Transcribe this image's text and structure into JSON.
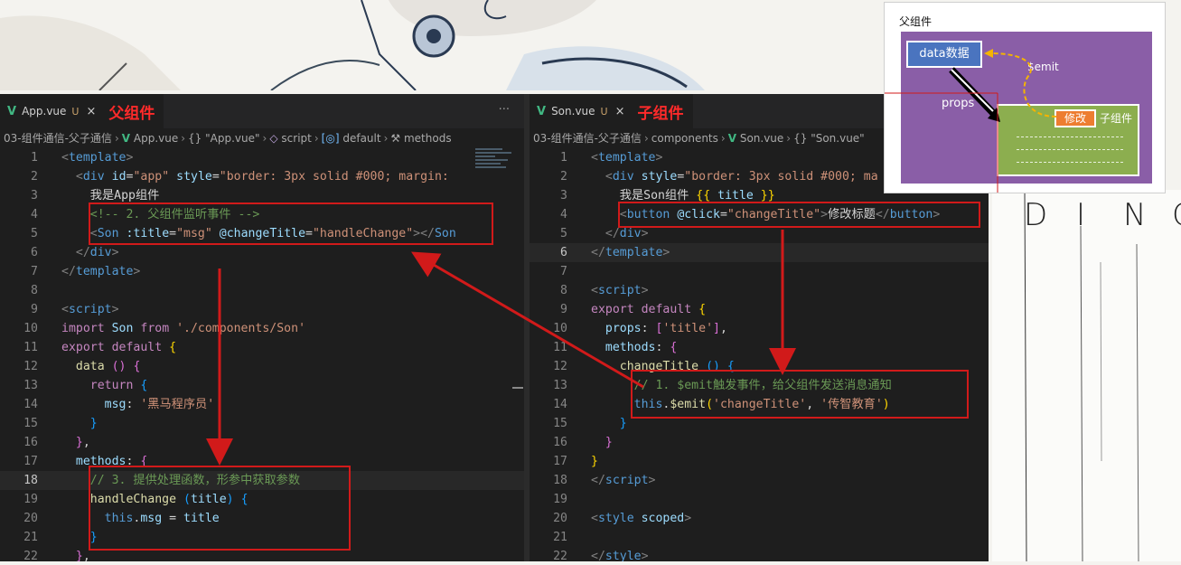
{
  "left_editor": {
    "tab_name": "App.vue",
    "tab_status": "U",
    "annotation": "父组件",
    "more": "···",
    "breadcrumb": [
      "03-组件通信-父子通信",
      "App.vue",
      "{} \"App.vue\"",
      "script",
      "default",
      "methods"
    ],
    "lines": [
      [
        [
          "t-punc",
          "<"
        ],
        [
          "t-tag",
          "template"
        ],
        [
          "t-punc",
          ">"
        ]
      ],
      [
        [
          "t-plain",
          "  "
        ],
        [
          "t-punc",
          "<"
        ],
        [
          "t-tag",
          "div"
        ],
        [
          "t-plain",
          " "
        ],
        [
          "t-attr",
          "id"
        ],
        [
          "t-plain",
          "="
        ],
        [
          "t-str",
          "\"app\""
        ],
        [
          "t-plain",
          " "
        ],
        [
          "t-attr",
          "style"
        ],
        [
          "t-plain",
          "="
        ],
        [
          "t-str",
          "\"border: 3px solid #000; margin:"
        ]
      ],
      [
        [
          "t-plain",
          "    我是App组件"
        ]
      ],
      [
        [
          "t-plain",
          "    "
        ],
        [
          "t-com",
          "<!-- 2. 父组件监听事件 -->"
        ]
      ],
      [
        [
          "t-plain",
          "    "
        ],
        [
          "t-punc",
          "<"
        ],
        [
          "t-tag",
          "Son"
        ],
        [
          "t-plain",
          " "
        ],
        [
          "t-attr",
          ":title"
        ],
        [
          "t-plain",
          "="
        ],
        [
          "t-str",
          "\"msg\""
        ],
        [
          "t-plain",
          " "
        ],
        [
          "t-attr",
          "@changeTitle"
        ],
        [
          "t-plain",
          "="
        ],
        [
          "t-str",
          "\"handleChange\""
        ],
        [
          "t-punc",
          "></"
        ],
        [
          "t-tag",
          "Son"
        ]
      ],
      [
        [
          "t-plain",
          "  "
        ],
        [
          "t-punc",
          "</"
        ],
        [
          "t-tag",
          "div"
        ],
        [
          "t-punc",
          ">"
        ]
      ],
      [
        [
          "t-punc",
          "</"
        ],
        [
          "t-tag",
          "template"
        ],
        [
          "t-punc",
          ">"
        ]
      ],
      [
        [
          "t-plain",
          ""
        ]
      ],
      [
        [
          "t-punc",
          "<"
        ],
        [
          "t-tag",
          "script"
        ],
        [
          "t-punc",
          ">"
        ]
      ],
      [
        [
          "t-kw",
          "import"
        ],
        [
          "t-plain",
          " "
        ],
        [
          "t-prop",
          "Son"
        ],
        [
          "t-plain",
          " "
        ],
        [
          "t-kw",
          "from"
        ],
        [
          "t-plain",
          " "
        ],
        [
          "t-str",
          "'./components/Son'"
        ]
      ],
      [
        [
          "t-kw",
          "export"
        ],
        [
          "t-plain",
          " "
        ],
        [
          "t-kw",
          "default"
        ],
        [
          "t-plain",
          " "
        ],
        [
          "t-br1",
          "{"
        ]
      ],
      [
        [
          "t-plain",
          "  "
        ],
        [
          "t-fn",
          "data"
        ],
        [
          "t-plain",
          " "
        ],
        [
          "t-br2",
          "()"
        ],
        [
          "t-plain",
          " "
        ],
        [
          "t-br2",
          "{"
        ]
      ],
      [
        [
          "t-plain",
          "    "
        ],
        [
          "t-kw",
          "return"
        ],
        [
          "t-plain",
          " "
        ],
        [
          "t-br3",
          "{"
        ]
      ],
      [
        [
          "t-plain",
          "      "
        ],
        [
          "t-prop",
          "msg"
        ],
        [
          "t-plain",
          ": "
        ],
        [
          "t-str",
          "'黑马程序员'"
        ]
      ],
      [
        [
          "t-plain",
          "    "
        ],
        [
          "t-br3",
          "}"
        ]
      ],
      [
        [
          "t-plain",
          "  "
        ],
        [
          "t-br2",
          "}"
        ],
        [
          "t-plain",
          ","
        ]
      ],
      [
        [
          "t-plain",
          "  "
        ],
        [
          "t-prop",
          "methods"
        ],
        [
          "t-plain",
          ": "
        ],
        [
          "t-br2",
          "{"
        ]
      ],
      [
        [
          "t-plain",
          "    "
        ],
        [
          "t-com",
          "// 3. 提供处理函数，形参中获取参数"
        ]
      ],
      [
        [
          "t-plain",
          "    "
        ],
        [
          "t-fn",
          "handleChange"
        ],
        [
          "t-plain",
          " "
        ],
        [
          "t-br3",
          "("
        ],
        [
          "t-prop",
          "title"
        ],
        [
          "t-br3",
          ")"
        ],
        [
          "t-plain",
          " "
        ],
        [
          "t-br3",
          "{"
        ]
      ],
      [
        [
          "t-plain",
          "      "
        ],
        [
          "t-this",
          "this"
        ],
        [
          "t-plain",
          "."
        ],
        [
          "t-prop",
          "msg"
        ],
        [
          "t-plain",
          " = "
        ],
        [
          "t-prop",
          "title"
        ]
      ],
      [
        [
          "t-plain",
          "    "
        ],
        [
          "t-br3",
          "}"
        ]
      ],
      [
        [
          "t-plain",
          "  "
        ],
        [
          "t-br2",
          "}"
        ],
        [
          "t-plain",
          ","
        ]
      ]
    ],
    "active_line": 18
  },
  "right_editor": {
    "tab_name": "Son.vue",
    "tab_status": "U",
    "annotation": "子组件",
    "breadcrumb": [
      "03-组件通信-父子通信",
      "components",
      "Son.vue",
      "{} \"Son.vue\""
    ],
    "lines": [
      [
        [
          "t-punc",
          "<"
        ],
        [
          "t-tag",
          "template"
        ],
        [
          "t-punc",
          ">"
        ]
      ],
      [
        [
          "t-plain",
          "  "
        ],
        [
          "t-punc",
          "<"
        ],
        [
          "t-tag",
          "div"
        ],
        [
          "t-plain",
          " "
        ],
        [
          "t-attr",
          "style"
        ],
        [
          "t-plain",
          "="
        ],
        [
          "t-str",
          "\"border: 3px solid #000; ma"
        ]
      ],
      [
        [
          "t-plain",
          "    我是Son组件 "
        ],
        [
          "t-br1",
          "{{"
        ],
        [
          "t-plain",
          " "
        ],
        [
          "t-prop",
          "title"
        ],
        [
          "t-plain",
          " "
        ],
        [
          "t-br1",
          "}}"
        ]
      ],
      [
        [
          "t-plain",
          "    "
        ],
        [
          "t-punc",
          "<"
        ],
        [
          "t-tag",
          "button"
        ],
        [
          "t-plain",
          " "
        ],
        [
          "t-attr",
          "@click"
        ],
        [
          "t-plain",
          "="
        ],
        [
          "t-str",
          "\"changeTitle\""
        ],
        [
          "t-punc",
          ">"
        ],
        [
          "t-plain",
          "修改标题"
        ],
        [
          "t-punc",
          "</"
        ],
        [
          "t-tag",
          "button"
        ],
        [
          "t-punc",
          ">"
        ]
      ],
      [
        [
          "t-plain",
          "  "
        ],
        [
          "t-punc",
          "</"
        ],
        [
          "t-tag",
          "div"
        ],
        [
          "t-punc",
          ">"
        ]
      ],
      [
        [
          "t-punc",
          "</"
        ],
        [
          "t-tag",
          "template"
        ],
        [
          "t-punc",
          ">"
        ]
      ],
      [
        [
          "t-plain",
          ""
        ]
      ],
      [
        [
          "t-punc",
          "<"
        ],
        [
          "t-tag",
          "script"
        ],
        [
          "t-punc",
          ">"
        ]
      ],
      [
        [
          "t-kw",
          "export"
        ],
        [
          "t-plain",
          " "
        ],
        [
          "t-kw",
          "default"
        ],
        [
          "t-plain",
          " "
        ],
        [
          "t-br1",
          "{"
        ]
      ],
      [
        [
          "t-plain",
          "  "
        ],
        [
          "t-prop",
          "props"
        ],
        [
          "t-plain",
          ": "
        ],
        [
          "t-br2",
          "["
        ],
        [
          "t-str",
          "'title'"
        ],
        [
          "t-br2",
          "]"
        ],
        [
          "t-plain",
          ","
        ]
      ],
      [
        [
          "t-plain",
          "  "
        ],
        [
          "t-prop",
          "methods"
        ],
        [
          "t-plain",
          ": "
        ],
        [
          "t-br2",
          "{"
        ]
      ],
      [
        [
          "t-plain",
          "    "
        ],
        [
          "t-fn",
          "changeTitle"
        ],
        [
          "t-plain",
          " "
        ],
        [
          "t-br3",
          "()"
        ],
        [
          "t-plain",
          " "
        ],
        [
          "t-br3",
          "{"
        ]
      ],
      [
        [
          "t-plain",
          "      "
        ],
        [
          "t-com",
          "// 1. $emit触发事件，给父组件发送消息通知"
        ]
      ],
      [
        [
          "t-plain",
          "      "
        ],
        [
          "t-this",
          "this"
        ],
        [
          "t-plain",
          "."
        ],
        [
          "t-fn",
          "$emit"
        ],
        [
          "t-br1",
          "("
        ],
        [
          "t-str",
          "'changeTitle'"
        ],
        [
          "t-plain",
          ", "
        ],
        [
          "t-str",
          "'传智教育'"
        ],
        [
          "t-br1",
          ")"
        ]
      ],
      [
        [
          "t-plain",
          "    "
        ],
        [
          "t-br3",
          "}"
        ]
      ],
      [
        [
          "t-plain",
          "  "
        ],
        [
          "t-br2",
          "}"
        ]
      ],
      [
        [
          "t-br1",
          "}"
        ]
      ],
      [
        [
          "t-punc",
          "</"
        ],
        [
          "t-tag",
          "script"
        ],
        [
          "t-punc",
          ">"
        ]
      ],
      [
        [
          "t-plain",
          ""
        ]
      ],
      [
        [
          "t-punc",
          "<"
        ],
        [
          "t-tag",
          "style"
        ],
        [
          "t-plain",
          " "
        ],
        [
          "t-attr",
          "scoped"
        ],
        [
          "t-punc",
          ">"
        ]
      ],
      [
        [
          "t-plain",
          ""
        ]
      ],
      [
        [
          "t-punc",
          "</"
        ],
        [
          "t-tag",
          "style"
        ],
        [
          "t-punc",
          ">"
        ]
      ]
    ],
    "active_line": 6
  },
  "diagram": {
    "title": "父组件",
    "data_label": "data数据",
    "emit_label": "$emit",
    "props_label": "props",
    "modify_label": "修改",
    "child_label": "子组件",
    "dash_text": "------------------"
  },
  "backdrop": {
    "letters": [
      "D",
      "I",
      "N",
      "C"
    ]
  },
  "colors": {
    "annotation_red": "#d11a1a",
    "diagram_parent": "#8a5ea7",
    "diagram_child": "#8cae4f",
    "diagram_data": "#4a74bf",
    "diagram_modify": "#ed7d31",
    "vue_green": "#41b883"
  }
}
